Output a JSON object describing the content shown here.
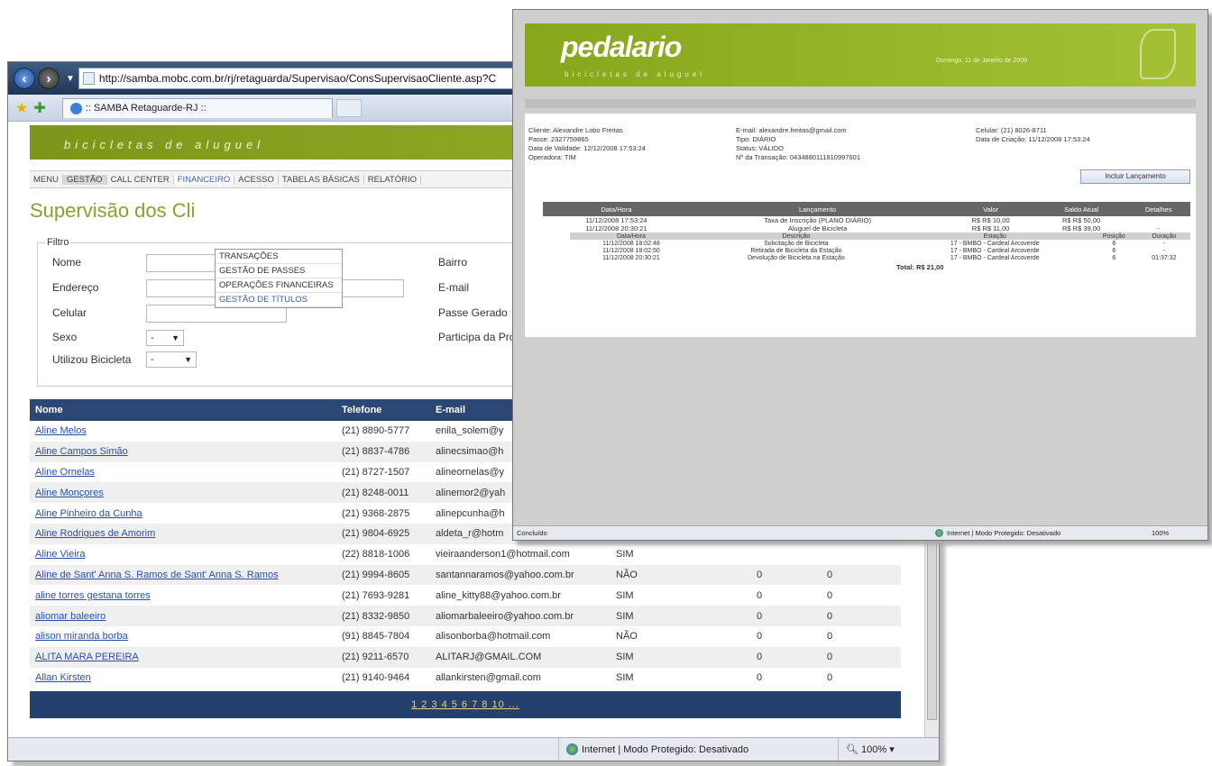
{
  "back_window": {
    "url": "http://samba.mobc.com.br/rj/retaguarda/Supervisao/ConsSupervisaoCliente.asp?C",
    "tab_title": ":: SAMBA Retaguarde-RJ ::",
    "banner_text": "bicicletas de aluguel",
    "menu": [
      "MENU",
      "GESTÃO",
      "CALL CENTER",
      "FINANCEIRO",
      "ACESSO",
      "TABELAS BÁSICAS",
      "RELATÓRIO"
    ],
    "submenu": [
      "TRANSAÇÕES",
      "GESTÃO DE PASSES",
      "OPERAÇÕES FINANCEIRAS",
      "GESTÃO DE TÍTULOS"
    ],
    "page_title": "Supervisão dos Cli",
    "filtro": {
      "legend": "Filtro",
      "labels": [
        "Nome",
        "Endereço",
        "Celular",
        "Sexo",
        "Utilizou Bicicleta"
      ],
      "right_labels": [
        "Bairro",
        "E-mail",
        "Passe Gerado",
        "Participa da Pro"
      ],
      "sexo_value": "-",
      "bicicleta_value": "-"
    },
    "grid": {
      "headers": [
        "Nome",
        "Telefone",
        "E-mail",
        "",
        "",
        ""
      ],
      "rows": [
        [
          "Aline Melos",
          "(21) 8890-5777",
          "enila_solem@y",
          "",
          "",
          ""
        ],
        [
          "Aline Campos Simão",
          "(21) 8837-4786",
          "alinecsimao@h",
          "",
          "",
          ""
        ],
        [
          "Aline Ornelas",
          "(21) 8727-1507",
          "alineornelas@y",
          "",
          "",
          ""
        ],
        [
          "Aline Monçores",
          "(21) 8248-0011",
          "alinemor2@yah",
          "",
          "",
          ""
        ],
        [
          "Aline Pinheiro da Cunha",
          "(21) 9368-2875",
          "alinepcunha@h",
          "",
          "",
          ""
        ],
        [
          "Aline Rodrigues de Amorim",
          "(21) 9804-6925",
          "aldeta_r@hotm",
          "",
          "",
          ""
        ],
        [
          "Aline Vieira",
          "(22) 8818-1006",
          "vieiraanderson1@hotmail.com",
          "SIM",
          "",
          ""
        ],
        [
          "Aline de Sant' Anna S. Ramos de Sant' Anna S. Ramos",
          "(21) 9994-8605",
          "santannaramos@yahoo.com.br",
          "NÃO",
          "0",
          "0"
        ],
        [
          "aline torres gestana torres",
          "(21) 7693-9281",
          "aline_kitty88@yahoo.com.br",
          "SIM",
          "0",
          "0"
        ],
        [
          "aliomar baleeiro",
          "(21) 8332-9850",
          "aliomarbaleeiro@yahoo.com.br",
          "SIM",
          "0",
          "0"
        ],
        [
          "alison miranda borba",
          "(91) 8845-7804",
          "alisonborba@hotmail.com",
          "NÃO",
          "0",
          "0"
        ],
        [
          "ALITA MARA PEREIRA",
          "(21) 9211-6570",
          "ALITARJ@GMAIL.COM",
          "SIM",
          "0",
          "0"
        ],
        [
          "Allan Kirsten",
          "(21) 9140-9464",
          "allankirsten@gmail.com",
          "SIM",
          "0",
          "0"
        ]
      ]
    },
    "pager": "1 2 3 4 5 6 7 8  10 ...",
    "status": "Internet | Modo Protegido: Desativado",
    "zoom": "100%"
  },
  "front_window": {
    "logo": "pedalario",
    "logo_sub": "bicicletas de aluguel",
    "header_date": "Domingo, 11 de Janeiro de 2009",
    "info": {
      "cliente": "Cliente: Alexandre Lobo Freitas",
      "passe": "Passe: 2327759865",
      "data_validade": "Data de Validade: 12/12/2008 17:53:24",
      "operadora": "Operadora: TIM",
      "email": "E-mail: alexandre.freitas@gmail.com",
      "tipo": "Tipo: DIÁRIO",
      "status": "Status: VÁLIDO",
      "transacao": "Nº da Transação: 0434880111810997601",
      "celular": "Celular: (21) 8026-8711",
      "data_criacao": "Data de Criação: 11/12/2008 17:53:24"
    },
    "button": "Incluir Lançamento",
    "lanc_headers": [
      "Data/Hora",
      "Lançamento",
      "Valor",
      "Saldo Atual",
      "Detalhes"
    ],
    "lanc_rows": [
      [
        "11/12/2008 17:53:24",
        "Taxa de Inscrição (PLANO DIÁRIO)",
        "R$ R$ 10,00",
        "R$ R$ 50,00",
        ""
      ],
      [
        "11/12/2008 20:30:21",
        "Aluguel de Bicicleta",
        "R$ R$ 11,00",
        "R$ R$ 39,00",
        "-"
      ]
    ],
    "sub_headers": [
      "Data/Hora",
      "Descrição",
      "Estação",
      "Posição",
      "Duração"
    ],
    "sub_rows": [
      [
        "11/12/2008 18:02:48",
        "Solicitação de Bicicleta",
        "17 - BMBO - Cardeal Arcoverde",
        "6",
        "-"
      ],
      [
        "11/12/2008 18:02:50",
        "Retirada de Bicicleta da Estação",
        "17 - BMBO - Cardeal Arcoverde",
        "6",
        "-"
      ],
      [
        "11/12/2008 20:30:21",
        "Devolução de Bicicleta na Estação",
        "17 - BMBO - Cardeal Arcoverde",
        "6",
        "01:37:32"
      ]
    ],
    "total": "Total:     R$ 21,00",
    "status_left": "Concluído",
    "status_mid": "Internet | Modo Protegido: Desativado",
    "zoom": "100%"
  }
}
